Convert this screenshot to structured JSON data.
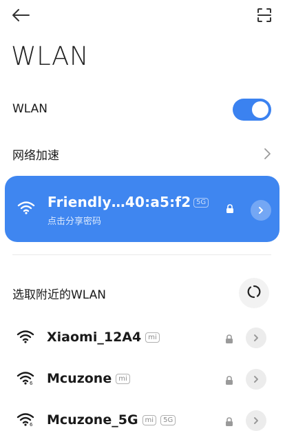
{
  "header": {
    "title": "WLAN",
    "back_icon": "arrow-left-icon",
    "scan_icon": "scan-icon"
  },
  "wlan_toggle": {
    "label": "WLAN",
    "on": true,
    "accent": "#3b82f0"
  },
  "accel": {
    "label": "网络加速"
  },
  "connected": {
    "name": "Friendly…40:a5:f2",
    "subtitle": "点击分享密码",
    "band": "5G",
    "background": "#3f86f0"
  },
  "nearby": {
    "title": "选取附近的WLAN",
    "networks": [
      {
        "name": "Xiaomi_12A4",
        "tags": [
          "mi"
        ],
        "wifi_badge": "",
        "secured": true
      },
      {
        "name": "Mcuzone",
        "tags": [
          "mi"
        ],
        "wifi_badge": "6",
        "secured": true
      },
      {
        "name": "Mcuzone_5G",
        "tags": [
          "mi",
          "5G"
        ],
        "wifi_badge": "6",
        "secured": true
      }
    ]
  }
}
